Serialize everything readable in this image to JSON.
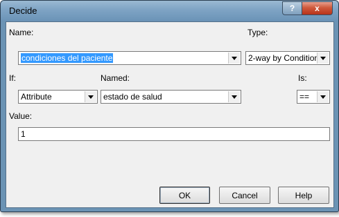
{
  "window": {
    "title": "Decide",
    "help_glyph": "?",
    "close_glyph": "x"
  },
  "form": {
    "name_label": "Name:",
    "name_value": "condiciones del paciente",
    "type_label": "Type:",
    "type_value": "2-way by Condition",
    "if_label": "If:",
    "if_value": "Attribute",
    "named_label": "Named:",
    "named_value": "estado de salud",
    "is_label": "Is:",
    "is_value": "==",
    "value_label": "Value:",
    "value_value": "1"
  },
  "buttons": {
    "ok": "OK",
    "cancel": "Cancel",
    "help": "Help"
  },
  "icons": {
    "dropdown": "chevron-down-icon"
  },
  "colors": {
    "selection": "#3399ff",
    "titlebar": "#7ea3c4",
    "close": "#c7452a"
  }
}
